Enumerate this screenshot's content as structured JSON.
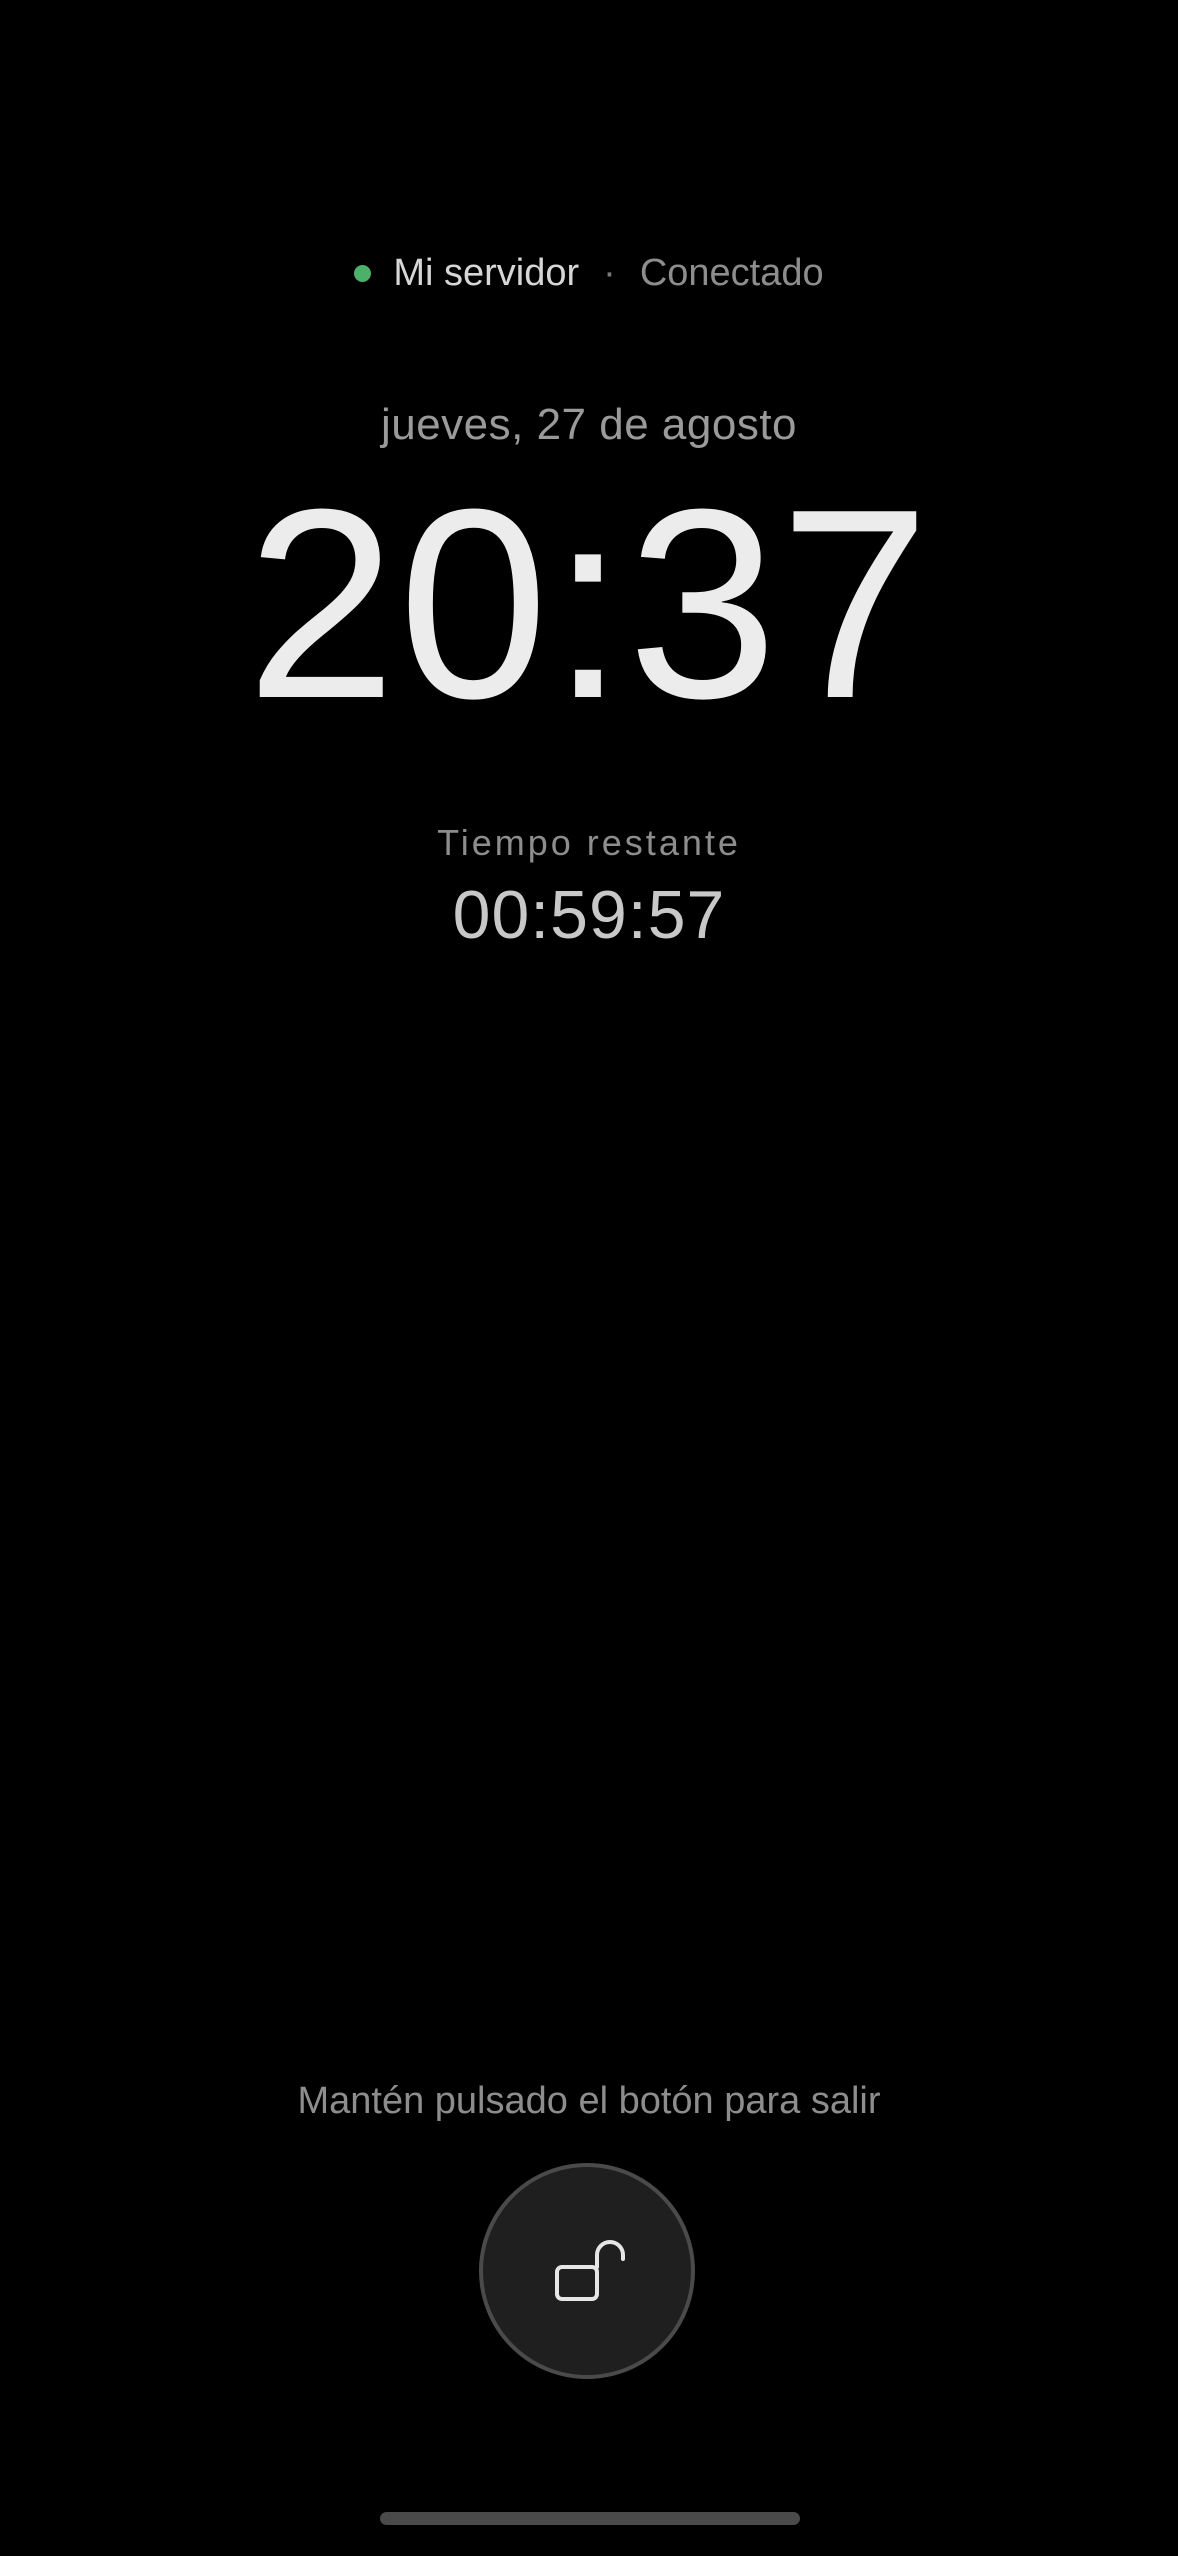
{
  "connection": {
    "server_name": "Mi servidor",
    "separator": "·",
    "status": "Conectado",
    "status_color": "#4caf6a"
  },
  "date_text": "jueves, 27 de agosto",
  "clock_time": "20:37",
  "remaining": {
    "label": "Tiempo restante",
    "value": "00:59:57"
  },
  "exit_hint": "Mantén pulsado el botón para salir",
  "unlock_button": {
    "icon": "unlocked-padlock-icon"
  }
}
